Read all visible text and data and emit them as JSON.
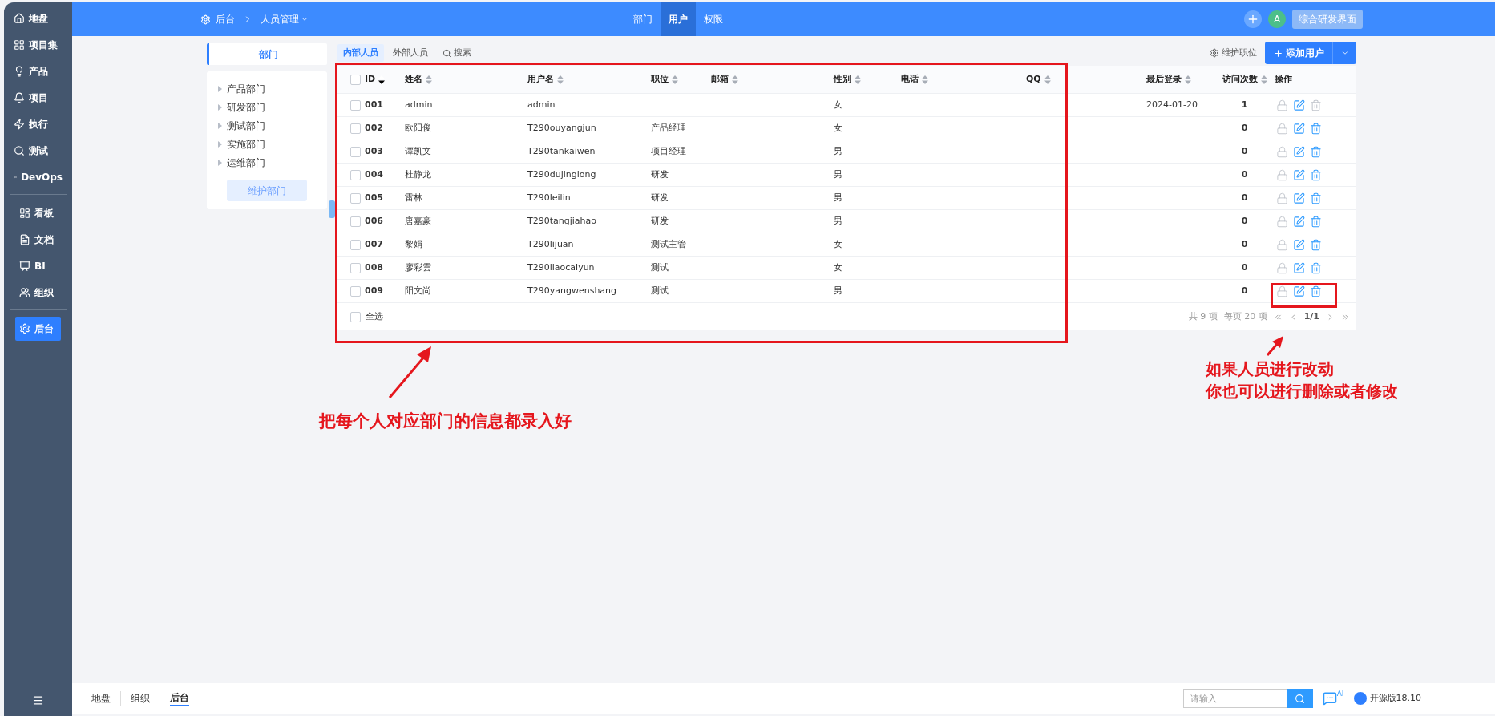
{
  "sidebar": {
    "groups": [
      [
        {
          "label": "地盘",
          "selected": false
        },
        {
          "label": "项目集",
          "selected": false
        },
        {
          "label": "产品",
          "selected": false
        },
        {
          "label": "项目",
          "selected": false
        },
        {
          "label": "执行",
          "selected": false
        },
        {
          "label": "测试",
          "selected": false
        },
        {
          "label": "DevOps",
          "selected": false
        }
      ],
      [
        {
          "label": "看板",
          "selected": false
        },
        {
          "label": "文档",
          "selected": false
        },
        {
          "label": "BI",
          "selected": false
        },
        {
          "label": "组织",
          "selected": false
        }
      ],
      [
        {
          "label": "后台",
          "selected": true
        }
      ]
    ]
  },
  "header": {
    "breadcrumb": [
      "后台",
      "人员管理"
    ],
    "nav": [
      {
        "label": "部门",
        "selected": false
      },
      {
        "label": "用户",
        "selected": true
      },
      {
        "label": "权限",
        "selected": false
      }
    ],
    "avatar": "A",
    "workspace_button": "综合研发界面"
  },
  "departments": {
    "title": "部门",
    "items": [
      "产品部门",
      "研发部门",
      "测试部门",
      "实施部门",
      "运维部门"
    ],
    "button": "维护部门"
  },
  "subtabs": [
    {
      "label": "内部人员",
      "selected": true,
      "kind": "tab"
    },
    {
      "label": "外部人员",
      "selected": false,
      "kind": "tab"
    },
    {
      "label": "搜索",
      "selected": false,
      "kind": "search"
    }
  ],
  "actions": {
    "positions": "维护职位",
    "add_user": "添加用户"
  },
  "table": {
    "header_checked": false,
    "columns": [
      {
        "label": "ID",
        "sortable": true,
        "sorted": true
      },
      {
        "label": "姓名",
        "sortable": true,
        "sorted": false
      },
      {
        "label": "用户名",
        "sortable": true,
        "sorted": false
      },
      {
        "label": "职位",
        "sortable": true,
        "sorted": false
      },
      {
        "label": "邮箱",
        "sortable": true,
        "sorted": false
      },
      {
        "label": "性别",
        "sortable": true,
        "sorted": false
      },
      {
        "label": "电话",
        "sortable": true,
        "sorted": false
      },
      {
        "label": "QQ",
        "sortable": true,
        "sorted": false
      },
      {
        "label": "最后登录",
        "sortable": true,
        "sorted": false
      },
      {
        "label": "访问次数",
        "sortable": true,
        "sorted": false
      },
      {
        "label": "操作",
        "sortable": false,
        "sorted": false
      }
    ],
    "rows": [
      {
        "checked": false,
        "can_delete": false,
        "cells": [
          "001",
          "admin",
          "admin",
          "",
          "",
          "女",
          "",
          "",
          "2024-01-20",
          "1"
        ]
      },
      {
        "checked": false,
        "can_delete": true,
        "cells": [
          "002",
          "欧阳俊",
          "T290ouyangjun",
          "产品经理",
          "",
          "女",
          "",
          "",
          "",
          "0"
        ]
      },
      {
        "checked": false,
        "can_delete": true,
        "cells": [
          "003",
          "谭凯文",
          "T290tankaiwen",
          "项目经理",
          "",
          "男",
          "",
          "",
          "",
          "0"
        ]
      },
      {
        "checked": false,
        "can_delete": true,
        "cells": [
          "004",
          "杜静龙",
          "T290dujinglong",
          "研发",
          "",
          "男",
          "",
          "",
          "",
          "0"
        ]
      },
      {
        "checked": false,
        "can_delete": true,
        "cells": [
          "005",
          "雷林",
          "T290leilin",
          "研发",
          "",
          "男",
          "",
          "",
          "",
          "0"
        ]
      },
      {
        "checked": false,
        "can_delete": true,
        "cells": [
          "006",
          "唐嘉豪",
          "T290tangjiahao",
          "研发",
          "",
          "男",
          "",
          "",
          "",
          "0"
        ]
      },
      {
        "checked": false,
        "can_delete": true,
        "cells": [
          "007",
          "黎娟",
          "T290lijuan",
          "测试主管",
          "",
          "女",
          "",
          "",
          "",
          "0"
        ]
      },
      {
        "checked": false,
        "can_delete": true,
        "cells": [
          "008",
          "廖彩雲",
          "T290liaocaiyun",
          "测试",
          "",
          "女",
          "",
          "",
          "",
          "0"
        ]
      },
      {
        "checked": false,
        "can_delete": true,
        "cells": [
          "009",
          "阳文尚",
          "T290yangwenshang",
          "测试",
          "",
          "男",
          "",
          "",
          "",
          "0"
        ]
      }
    ],
    "select_all": {
      "label": "全选",
      "checked": false
    },
    "pager": {
      "total": "共 9 项",
      "per_page": "每页 20 项",
      "page": "1/1"
    }
  },
  "bottom_bar": {
    "tabs": [
      {
        "label": "地盘",
        "selected": false
      },
      {
        "label": "组织",
        "selected": false
      },
      {
        "label": "后台",
        "selected": true
      }
    ],
    "search_placeholder": "请输入",
    "ai_badge": "AI",
    "version": "开源版18.10"
  },
  "annotations": [
    {
      "lines": [
        "把每个人对应部门的信息都录入好"
      ]
    },
    {
      "lines": [
        "如果人员进行改动",
        "你也可以进行删除或者修改"
      ]
    }
  ]
}
